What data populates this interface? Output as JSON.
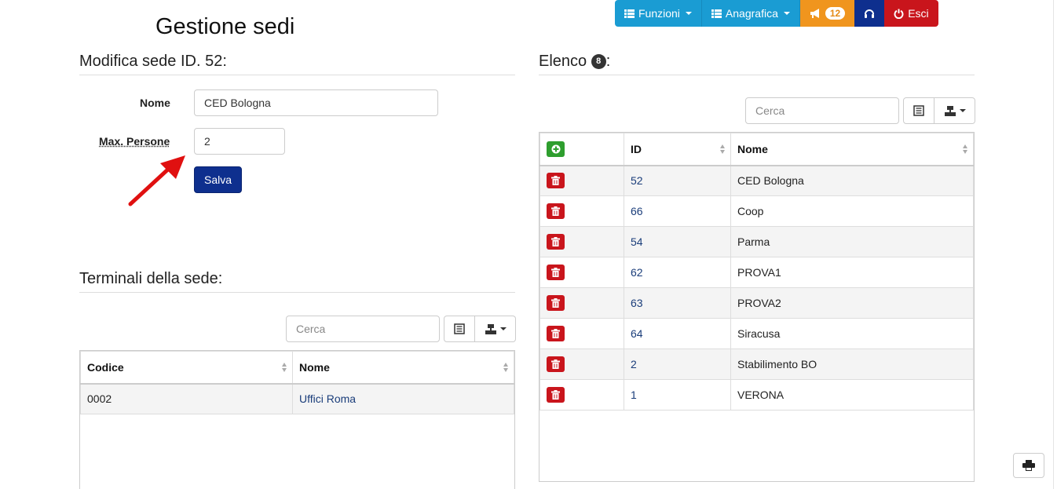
{
  "nav": {
    "funzioni": "Funzioni",
    "anagrafica": "Anagrafica",
    "notifications_count": "12",
    "esci": "Esci"
  },
  "page": {
    "title": "Gestione sedi"
  },
  "edit": {
    "heading": "Modifica sede ID. 52:",
    "nome_label": "Nome",
    "nome_value": "CED Bologna",
    "max_label": "Max. Persone",
    "max_value": "2",
    "save_label": "Salva"
  },
  "terminali": {
    "heading": "Terminali della sede:",
    "search_placeholder": "Cerca",
    "columns": [
      "Codice",
      "Nome"
    ],
    "rows": [
      {
        "codice": "0002",
        "nome": "Uffici Roma"
      }
    ]
  },
  "elenco": {
    "heading": "Elenco",
    "count": "8",
    "heading_suffix": ":",
    "search_placeholder": "Cerca",
    "columns": [
      "ID",
      "Nome"
    ],
    "rows": [
      {
        "id": "52",
        "nome": "CED Bologna"
      },
      {
        "id": "66",
        "nome": "Coop"
      },
      {
        "id": "54",
        "nome": "Parma"
      },
      {
        "id": "62",
        "nome": "PROVA1"
      },
      {
        "id": "63",
        "nome": "PROVA2"
      },
      {
        "id": "64",
        "nome": "Siracusa"
      },
      {
        "id": "2",
        "nome": "Stabilimento BO"
      },
      {
        "id": "1",
        "nome": "VERONA"
      }
    ]
  },
  "colors": {
    "nav_cyan": "#1a9cd3",
    "nav_orange": "#f0951e",
    "nav_navy": "#0e2f8e",
    "nav_red": "#c9151c",
    "delete": "#c9151c",
    "add": "#2e9e2e",
    "link": "#1a3d7a"
  },
  "icons": [
    "list-icon",
    "bullhorn-icon",
    "headphones-icon",
    "power-icon",
    "trash-icon",
    "plus-circle-icon",
    "print-icon",
    "export-icon",
    "columns-icon"
  ]
}
